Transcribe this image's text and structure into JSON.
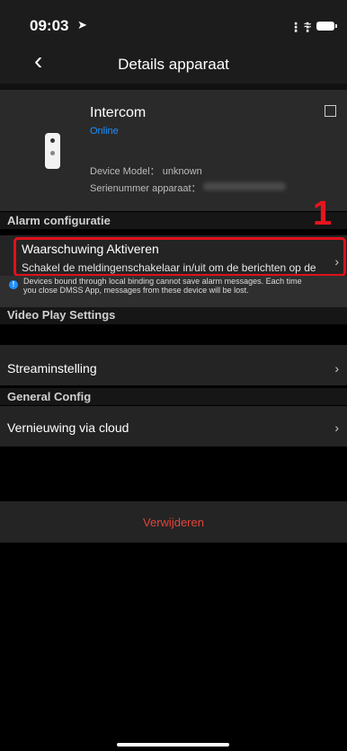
{
  "status": {
    "time": "09:03",
    "location_icon": "location-arrow-icon",
    "signal_icon": "signal-icon",
    "wifi_icon": "wifi-icon",
    "battery_icon": "battery-icon"
  },
  "nav": {
    "back_icon": "chevron-left-icon",
    "title": "Details apparaat"
  },
  "device": {
    "name": "Intercom",
    "status": "Online",
    "model_label": "Device Model：",
    "model_value": "unknown",
    "serial_label": "Serienummer apparaat："
  },
  "annotation": {
    "number": "1"
  },
  "sections": {
    "alarm": "Alarm configuratie",
    "video": "Video Play Settings",
    "general": "General Config"
  },
  "alarm_row": {
    "title": "Waarschuwing Aktiveren",
    "description": "Schakel de meldingenschakelaar in/uit om de berichten op de telefoon te beheren."
  },
  "note": {
    "text": "Devices bound through local binding cannot save alarm messages. Each time you close DMSS App, messages from these device will be lost."
  },
  "video_row": {
    "title": "Streaminstelling"
  },
  "general_row": {
    "title": "Vernieuwing via cloud"
  },
  "delete": {
    "label": "Verwijderen"
  },
  "colors": {
    "accent_blue": "#1e90ff",
    "danger_red": "#e0443a",
    "highlight_red": "#e0101c"
  }
}
